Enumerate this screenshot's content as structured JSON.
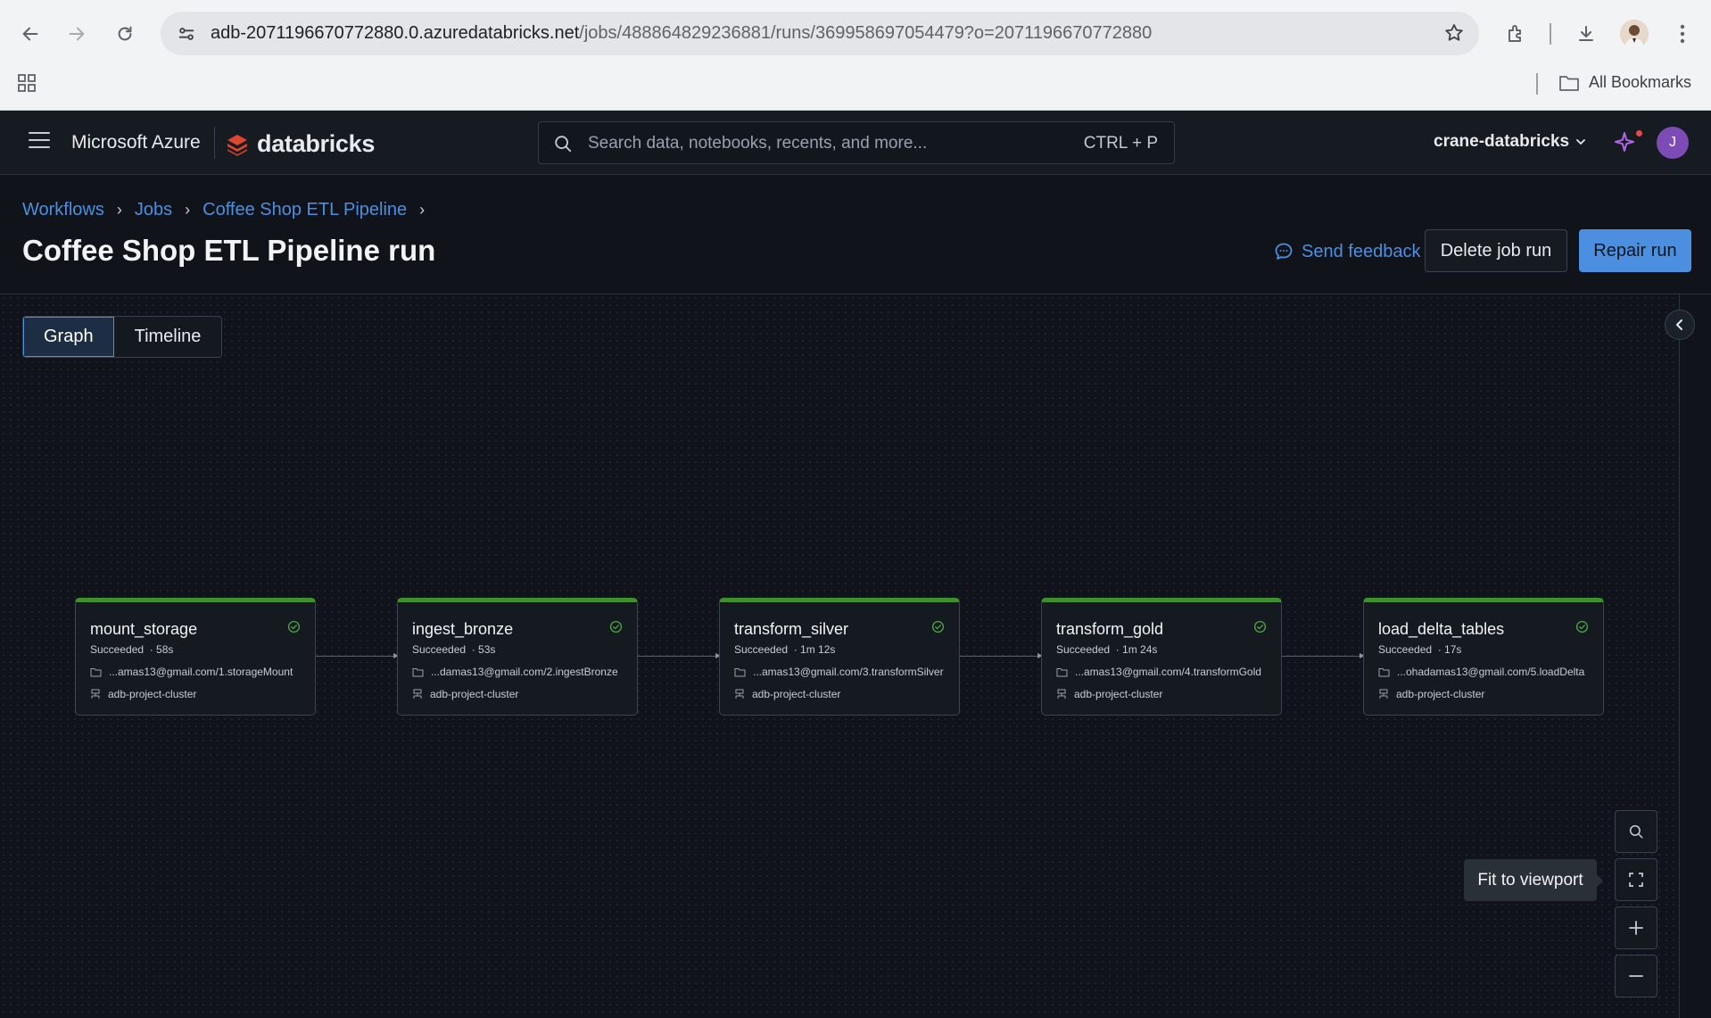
{
  "browser": {
    "url_host": "adb-2071196670772880.0.azuredatabricks.net",
    "url_path": "/jobs/488864829236881/runs/369958697054479?o=2071196670772880",
    "bookmarks_label": "All Bookmarks"
  },
  "header": {
    "brand": "Microsoft Azure",
    "product": "databricks",
    "search_placeholder": "Search data, notebooks, recents, and more...",
    "search_shortcut": "CTRL + P",
    "workspace": "crane-databricks",
    "user_initial": "J"
  },
  "breadcrumb": [
    "Workflows",
    "Jobs",
    "Coffee Shop ETL Pipeline"
  ],
  "page": {
    "title": "Coffee Shop ETL Pipeline run",
    "feedback_label": "Send feedback",
    "delete_label": "Delete job run",
    "repair_label": "Repair run"
  },
  "tabs": [
    {
      "label": "Graph",
      "active": true
    },
    {
      "label": "Timeline",
      "active": false
    }
  ],
  "tasks": [
    {
      "name": "mount_storage",
      "status": "Succeeded",
      "duration": "58s",
      "path": "...amas13@gmail.com/1.storageMount",
      "cluster": "adb-project-cluster"
    },
    {
      "name": "ingest_bronze",
      "status": "Succeeded",
      "duration": "53s",
      "path": "...damas13@gmail.com/2.ingestBronze",
      "cluster": "adb-project-cluster"
    },
    {
      "name": "transform_silver",
      "status": "Succeeded",
      "duration": "1m 12s",
      "path": "...amas13@gmail.com/3.transformSilver",
      "cluster": "adb-project-cluster"
    },
    {
      "name": "transform_gold",
      "status": "Succeeded",
      "duration": "1m 24s",
      "path": "...amas13@gmail.com/4.transformGold",
      "cluster": "adb-project-cluster"
    },
    {
      "name": "load_delta_tables",
      "status": "Succeeded",
      "duration": "17s",
      "path": "...ohadamas13@gmail.com/5.loadDelta",
      "cluster": "adb-project-cluster"
    }
  ],
  "canvas_controls": {
    "tooltip": "Fit to viewport"
  },
  "colors": {
    "accent": "#4c8fe0",
    "success": "#3f8f2c",
    "brand_red": "#e0452f"
  }
}
